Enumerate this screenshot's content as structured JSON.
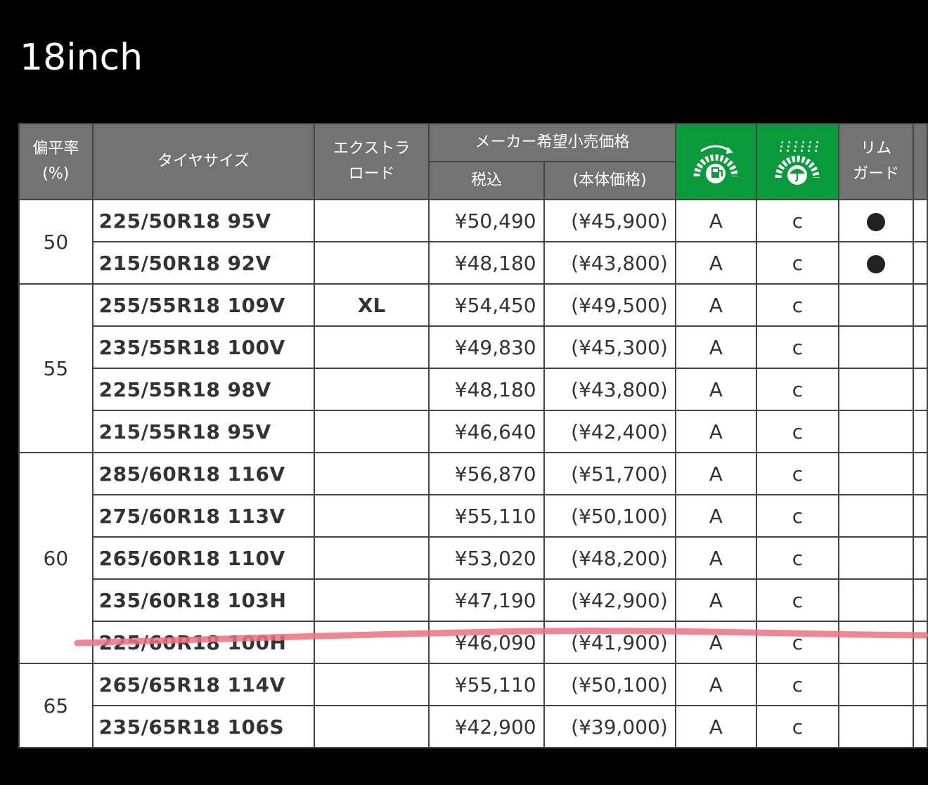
{
  "title": "18inch",
  "headers": {
    "ratio": [
      "偏平率",
      "(%)"
    ],
    "size": "タイヤサイズ",
    "extra_load": [
      "エクストラ",
      "ロード"
    ],
    "price_group": "メーカー希望小売価格",
    "price_tax": "税込",
    "price_base": "(本体価格)",
    "fuel_icon": "rolling-resistance-icon",
    "wet_icon": "wet-grip-icon",
    "rim_guard": [
      "リム",
      "ガード"
    ]
  },
  "colors": {
    "size_link": "#0d5aa7",
    "grade": "#0a9a3a",
    "header_bg": "#737373",
    "icon_bg": "#0a9a3a",
    "marker": "#f07080"
  },
  "groups": [
    {
      "ratio": "50",
      "rows": [
        {
          "size": "225/50R18 95V",
          "xl": "",
          "price_tax": "¥50,490",
          "price_base": "(¥45,900)",
          "fuel": "A",
          "wet": "c",
          "rim": true
        },
        {
          "size": "215/50R18 92V",
          "xl": "",
          "price_tax": "¥48,180",
          "price_base": "(¥43,800)",
          "fuel": "A",
          "wet": "c",
          "rim": true
        }
      ]
    },
    {
      "ratio": "55",
      "rows": [
        {
          "size": "255/55R18 109V",
          "xl": "XL",
          "price_tax": "¥54,450",
          "price_base": "(¥49,500)",
          "fuel": "A",
          "wet": "c",
          "rim": false
        },
        {
          "size": "235/55R18 100V",
          "xl": "",
          "price_tax": "¥49,830",
          "price_base": "(¥45,300)",
          "fuel": "A",
          "wet": "c",
          "rim": false
        },
        {
          "size": "225/55R18 98V",
          "xl": "",
          "price_tax": "¥48,180",
          "price_base": "(¥43,800)",
          "fuel": "A",
          "wet": "c",
          "rim": false
        },
        {
          "size": "215/55R18 95V",
          "xl": "",
          "price_tax": "¥46,640",
          "price_base": "(¥42,400)",
          "fuel": "A",
          "wet": "c",
          "rim": false
        }
      ]
    },
    {
      "ratio": "60",
      "rows": [
        {
          "size": "285/60R18 116V",
          "xl": "",
          "price_tax": "¥56,870",
          "price_base": "(¥51,700)",
          "fuel": "A",
          "wet": "c",
          "rim": false
        },
        {
          "size": "275/60R18 113V",
          "xl": "",
          "price_tax": "¥55,110",
          "price_base": "(¥50,100)",
          "fuel": "A",
          "wet": "c",
          "rim": false
        },
        {
          "size": "265/60R18 110V",
          "xl": "",
          "price_tax": "¥53,020",
          "price_base": "(¥48,200)",
          "fuel": "A",
          "wet": "c",
          "rim": false
        },
        {
          "size": "235/60R18 103H",
          "xl": "",
          "price_tax": "¥47,190",
          "price_base": "(¥42,900)",
          "fuel": "A",
          "wet": "c",
          "rim": false
        },
        {
          "size": "225/60R18 100H",
          "xl": "",
          "price_tax": "¥46,090",
          "price_base": "(¥41,900)",
          "fuel": "A",
          "wet": "c",
          "rim": false
        }
      ]
    },
    {
      "ratio": "65",
      "rows": [
        {
          "size": "265/65R18 114V",
          "xl": "",
          "price_tax": "¥55,110",
          "price_base": "(¥50,100)",
          "fuel": "A",
          "wet": "c",
          "rim": false
        },
        {
          "size": "235/65R18 106S",
          "xl": "",
          "price_tax": "¥42,900",
          "price_base": "(¥39,000)",
          "fuel": "A",
          "wet": "c",
          "rim": false
        }
      ]
    }
  ]
}
